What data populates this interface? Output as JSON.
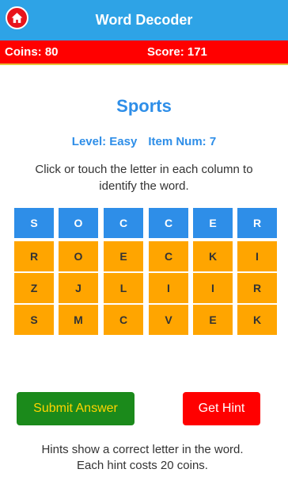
{
  "header": {
    "title": "Word Decoder",
    "home_icon": "home-icon"
  },
  "status": {
    "coins": "Coins: 80",
    "score": "Score: 171"
  },
  "puzzle": {
    "category": "Sports",
    "level": "Level: Easy",
    "item_num": "Item Num: 7",
    "instructions": "Click or touch the letter in each column to identify the word."
  },
  "grid": {
    "columns": [
      [
        "S",
        "R",
        "Z",
        "S"
      ],
      [
        "O",
        "O",
        "J",
        "M"
      ],
      [
        "C",
        "E",
        "L",
        "C"
      ],
      [
        "C",
        "C",
        "I",
        "V"
      ],
      [
        "E",
        "K",
        "I",
        "E"
      ],
      [
        "R",
        "I",
        "R",
        "K"
      ]
    ]
  },
  "actions": {
    "submit_label": "Submit Answer",
    "hint_label": "Get Hint"
  },
  "hint_info": {
    "line1": "Hints show a correct letter in the word.",
    "line2": "Each hint costs 20 coins."
  },
  "colors": {
    "header": "#2ea3e6",
    "status_bar": "#ff0000",
    "selected_cell": "#2e8ee8",
    "option_cell": "#ffa500",
    "submit_button": "#1b8a1b",
    "hint_button": "#ff0000"
  }
}
